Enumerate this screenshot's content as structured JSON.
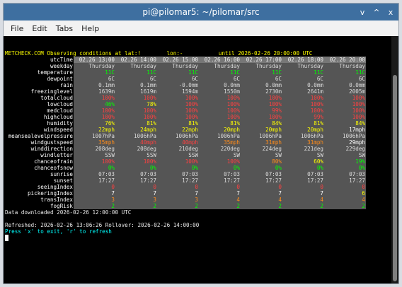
{
  "window": {
    "title": "pi@pilomar5: ~/pilomar/src",
    "controls": [
      "v",
      "^",
      "x"
    ]
  },
  "menubar": [
    "File",
    "Edit",
    "Tabs",
    "Help"
  ],
  "header": {
    "left": "METCHECK.COM Observing conditions at lat:",
    "lat": "!",
    "lon_label": "lon:-",
    "until": "until 2026-02-26 20:00:00 UTC"
  },
  "forecast": {
    "times": [
      "02.26 13:00",
      "02.26 14:00",
      "02.26 15:00",
      "02.26 16:00",
      "02.26 17:00",
      "02.26 18:00",
      "02.26 20:00"
    ],
    "rows": [
      {
        "label": "weekday",
        "values": [
          "Thursday",
          "Thursday",
          "Thursday",
          "Thursday",
          "Thursday",
          "Thursday",
          "Thursday"
        ],
        "colors": [
          "d",
          "d",
          "d",
          "d",
          "d",
          "d",
          "d"
        ]
      },
      {
        "label": "temperature",
        "values": [
          "11C",
          "11C",
          "11C",
          "11C",
          "11C",
          "11C",
          "11C"
        ],
        "colors": [
          "g",
          "g",
          "g",
          "g",
          "g",
          "g",
          "g"
        ]
      },
      {
        "label": "dewpoint",
        "values": [
          "6C",
          "6C",
          "6C",
          "6C",
          "6C",
          "6C",
          "6C"
        ],
        "colors": [
          "d",
          "d",
          "d",
          "d",
          "d",
          "d",
          "d"
        ]
      },
      {
        "label": "rain",
        "values": [
          "0.1mm",
          "0.1mm",
          "-0.0mm",
          "0.0mm",
          "0.0mm",
          "0.0mm",
          "0.0mm"
        ],
        "colors": [
          "d",
          "d",
          "d",
          "d",
          "d",
          "d",
          "d"
        ]
      },
      {
        "label": "freezinglevel",
        "values": [
          "1639m",
          "1619m",
          "1594m",
          "1550m",
          "2730m",
          "2641m",
          "2005m"
        ],
        "colors": [
          "d",
          "d",
          "d",
          "d",
          "d",
          "d",
          "d"
        ]
      },
      {
        "label": "totalcloud",
        "values": [
          "100%",
          "100%",
          "100%",
          "100%",
          "100%",
          "100%",
          "100%"
        ],
        "colors": [
          "r",
          "r",
          "r",
          "r",
          "r",
          "r",
          "r"
        ]
      },
      {
        "label": "lowcloud",
        "values": [
          "46%",
          "78%",
          "100%",
          "100%",
          "100%",
          "100%",
          "100%"
        ],
        "colors": [
          "g",
          "y",
          "r",
          "r",
          "r",
          "r",
          "r"
        ]
      },
      {
        "label": "medcloud",
        "values": [
          "100%",
          "100%",
          "100%",
          "100%",
          "99%",
          "100%",
          "100%"
        ],
        "colors": [
          "r",
          "r",
          "r",
          "r",
          "r",
          "r",
          "r"
        ]
      },
      {
        "label": "highcloud",
        "values": [
          "100%",
          "100%",
          "100%",
          "100%",
          "100%",
          "99%",
          "100%"
        ],
        "colors": [
          "r",
          "r",
          "r",
          "r",
          "r",
          "r",
          "r"
        ]
      },
      {
        "label": "humidity",
        "values": [
          "76%",
          "81%",
          "81%",
          "81%",
          "84%",
          "81%",
          "84%"
        ],
        "colors": [
          "y",
          "y",
          "y",
          "y",
          "y",
          "y",
          "y"
        ]
      },
      {
        "label": "windspeed",
        "values": [
          "22mph",
          "24mph",
          "22mph",
          "20mph",
          "20mph",
          "20mph",
          "17mph"
        ],
        "colors": [
          "y",
          "y",
          "y",
          "y",
          "y",
          "y",
          "w"
        ]
      },
      {
        "label": "meansealevelpressure",
        "values": [
          "1007hPa",
          "1006hPa",
          "1006hPa",
          "1006hPa",
          "1006hPa",
          "1006hPa",
          "1006hPa"
        ],
        "colors": [
          "d",
          "d",
          "d",
          "d",
          "d",
          "d",
          "d"
        ]
      },
      {
        "label": "windgustspeed",
        "values": [
          "35mph",
          "40mph",
          "40mph",
          "35mph",
          "31mph",
          "31mph",
          "29mph"
        ],
        "colors": [
          "o",
          "r",
          "r",
          "o",
          "o",
          "o",
          "w"
        ]
      },
      {
        "label": "winddirection",
        "values": [
          "208deg",
          "208deg",
          "210deg",
          "220deg",
          "224deg",
          "221deg",
          "229deg"
        ],
        "colors": [
          "d",
          "d",
          "d",
          "d",
          "d",
          "d",
          "d"
        ]
      },
      {
        "label": "windletter",
        "values": [
          "SSW",
          "SSW",
          "SSW",
          "SW",
          "SW",
          "SW",
          "SW"
        ],
        "colors": [
          "d",
          "d",
          "d",
          "d",
          "d",
          "d",
          "d"
        ]
      },
      {
        "label": "chanceofrain",
        "values": [
          "100%",
          "100%",
          "100%",
          "100%",
          "80%",
          "60%",
          "19%"
        ],
        "colors": [
          "r",
          "r",
          "r",
          "r",
          "o",
          "y",
          "g"
        ]
      },
      {
        "label": "chanceofsnow",
        "values": [
          "0%",
          "0%",
          "0%",
          "0%",
          "0%",
          "0%",
          "0%"
        ],
        "colors": [
          "g",
          "g",
          "g",
          "g",
          "g",
          "g",
          "g"
        ]
      },
      {
        "label": "sunrise",
        "values": [
          "07:03",
          "07:03",
          "07:03",
          "07:03",
          "07:03",
          "07:03",
          "07:03"
        ],
        "colors": [
          "d",
          "d",
          "d",
          "d",
          "d",
          "d",
          "d"
        ]
      },
      {
        "label": "sunset",
        "values": [
          "17:27",
          "17:27",
          "17:27",
          "17:27",
          "17:27",
          "17:27",
          "17:27"
        ],
        "colors": [
          "d",
          "d",
          "d",
          "d",
          "d",
          "d",
          "d"
        ]
      },
      {
        "label": "seeingIndex",
        "values": [
          "0",
          "0",
          "0",
          "0",
          "0",
          "0",
          "0"
        ],
        "colors": [
          "r",
          "r",
          "r",
          "r",
          "r",
          "r",
          "r"
        ]
      },
      {
        "label": "pickeringIndex",
        "values": [
          "7",
          "7",
          "7",
          "7",
          "7",
          "7",
          "6"
        ],
        "colors": [
          "w",
          "w",
          "w",
          "w",
          "w",
          "w",
          "y"
        ]
      },
      {
        "label": "transIndex",
        "values": [
          "3",
          "3",
          "3",
          "4",
          "4",
          "4",
          "4"
        ],
        "colors": [
          "o",
          "o",
          "o",
          "o",
          "o",
          "o",
          "o"
        ]
      },
      {
        "label": "fogRisk",
        "values": [
          "2",
          "2",
          "2",
          "2",
          "2",
          "2",
          "2"
        ],
        "colors": [
          "g",
          "g",
          "g",
          "g",
          "g",
          "g",
          "g"
        ]
      }
    ]
  },
  "footer": {
    "downloaded": "Data downloaded 2026-02-26 12:00:00 UTC",
    "refreshed": "Refreshed: 2026-02-26 13:06:26 Rollover: 2026-02-26 14:00:00",
    "help": "Press 'x' to exit, 'r' to refresh"
  }
}
